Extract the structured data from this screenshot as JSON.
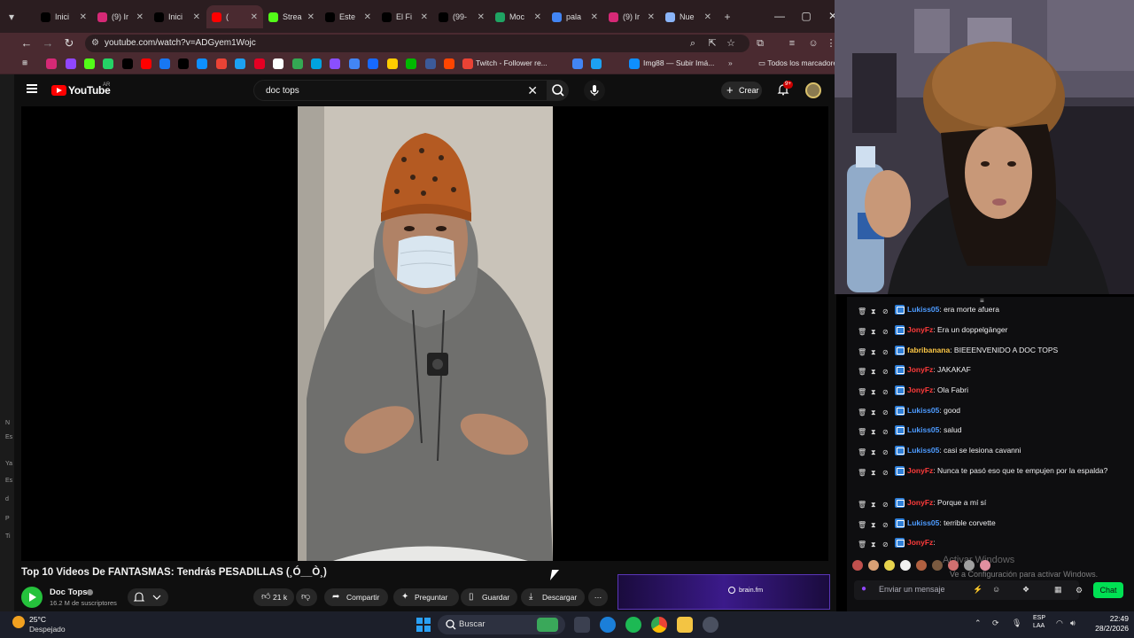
{
  "browser": {
    "tabs": [
      {
        "label": "Inici",
        "icon": "x-icon",
        "color": "#000000"
      },
      {
        "label": "(9) Ir",
        "icon": "instagram-icon",
        "color": "#d62976"
      },
      {
        "label": "Inici",
        "icon": "x-icon",
        "color": "#000000"
      },
      {
        "label": "(",
        "icon": "youtube-icon",
        "color": "#ff0000",
        "active": true
      },
      {
        "label": "Strea",
        "icon": "kick-icon",
        "color": "#53fc18"
      },
      {
        "label": "Este",
        "icon": "tiktok-icon",
        "color": "#000000"
      },
      {
        "label": "El Fi",
        "icon": "tiktok-icon",
        "color": "#000000"
      },
      {
        "label": "(99-",
        "icon": "tiktok-icon",
        "color": "#000000"
      },
      {
        "label": "Moc",
        "icon": "sheets-icon",
        "color": "#1fa463"
      },
      {
        "label": "pala",
        "icon": "google-icon",
        "color": "#4285f4"
      },
      {
        "label": "(9) Ir",
        "icon": "instagram-icon",
        "color": "#d62976"
      },
      {
        "label": "Nue",
        "icon": "globe-icon",
        "color": "#8ab4f8"
      }
    ],
    "url": "youtube.com/watch?v=ADGyem1Wojc",
    "bookmarks": {
      "twitch_label": "Twitch - Follower re...",
      "imgbb_label": "Img88 — Subir Imá...",
      "all_label": "Todos los marcadores",
      "icon_colors": [
        "#d62976",
        "#9146ff",
        "#53fc18",
        "#25d366",
        "#000000",
        "#ff0000",
        "#1877f2",
        "#000000",
        "#0e8fff",
        "#ea4335",
        "#1da1f2",
        "#e60023",
        "#ffffff",
        "#34a853",
        "#00a3e0",
        "#8a4fff",
        "#4285f4",
        "#1769ff",
        "#ffcc00",
        "#00b900",
        "#3c5a99",
        "#ff4500",
        "#ea4335"
      ]
    }
  },
  "youtube": {
    "logo_text": "YouTube",
    "country": "AR",
    "search_value": "doc tops",
    "create_label": "Crear",
    "notifications": "9+",
    "video_title": "Top 10 Videos De FANTASMAS: Tendrás PESADILLAS (¸Ó__Ò¸)",
    "channel_name": "Doc Tops",
    "channel_subs": "16.2 M de suscriptores",
    "likes": "21 k",
    "actions": {
      "share": "Compartir",
      "ask": "Preguntar",
      "save": "Guardar",
      "download": "Descargar",
      "more": "⋯"
    },
    "ad_text": "brain.fm",
    "left_edge_chars": [
      "Ar",
      "N",
      "Es",
      "Ya",
      "Es",
      "d",
      "P",
      "Ti"
    ]
  },
  "chat": {
    "messages": [
      {
        "user": "Lukiss05",
        "color": "#4d9bff",
        "text": ": era morte afuera",
        "bot": true
      },
      {
        "user": "JonyFz",
        "color": "#ff3b3b",
        "text": ": Era un doppelgänger",
        "bot": true
      },
      {
        "user": "fabribanana",
        "color": "#ffc845",
        "text": ": BIEEENVENIDO A DOC TOPS",
        "bot": true
      },
      {
        "user": "JonyFz",
        "color": "#ff3b3b",
        "text": ": JAKAKAF",
        "bot": true
      },
      {
        "user": "JonyFz",
        "color": "#ff3b3b",
        "text": ": Ola Fabri",
        "bot": true
      },
      {
        "user": "Lukiss05",
        "color": "#4d9bff",
        "text": ": good",
        "bot": true
      },
      {
        "user": "Lukiss05",
        "color": "#4d9bff",
        "text": ": salud",
        "bot": true
      },
      {
        "user": "Lukiss05",
        "color": "#4d9bff",
        "text": ": casi se lesiona cavanni",
        "bot": true
      },
      {
        "user": "JonyFz",
        "color": "#ff3b3b",
        "text": ": Nunca te pasó eso que te empujen por la espalda?",
        "bot": true
      },
      {
        "user": "JonyFz",
        "color": "#ff3b3b",
        "text": ": Porque a mí sí",
        "bot": true
      },
      {
        "user": "Lukiss05",
        "color": "#4d9bff",
        "text": ": terrible corvette",
        "bot": true
      },
      {
        "user": "JonyFz",
        "color": "#ff3b3b",
        "text": ":",
        "bot": true
      }
    ],
    "input_placeholder": "Enviar un mensaje",
    "chat_button": "Chat",
    "watermark_big": "Activar Windows",
    "watermark_small": "Ve a Configuración para activar Windows."
  },
  "taskbar": {
    "temperature": "25°C",
    "weather": "Despejado",
    "search_placeholder": "Buscar",
    "lang_1": "ESP",
    "lang_2": "LAA",
    "time": "22:49",
    "date": "28/2/2026"
  }
}
